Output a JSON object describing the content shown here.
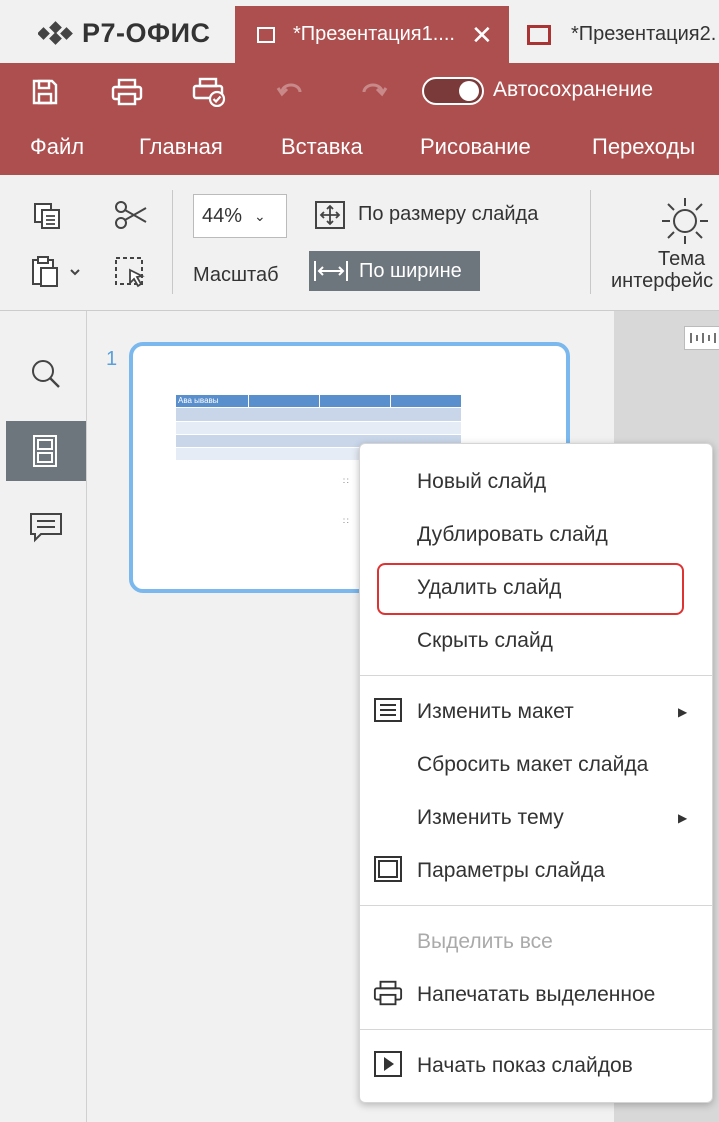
{
  "app": {
    "logo": "Р7-ОФИС"
  },
  "tabs": [
    {
      "label": "*Презентация1....",
      "close": "✕",
      "active": true
    },
    {
      "label": "*Презентация2.",
      "active": false
    }
  ],
  "quick_toolbar": {
    "icons": [
      "save-icon",
      "print-icon",
      "quick-print-icon",
      "undo-icon",
      "redo-icon"
    ],
    "autosave_label": "Автосохранение"
  },
  "menu": [
    "Файл",
    "Главная",
    "Вставка",
    "Рисование",
    "Переходы"
  ],
  "ribbon": {
    "zoom_value": "44%",
    "fit_slide_label": "По размеру слайда",
    "scale_label": "Масштаб",
    "fit_width_label": "По ширине",
    "theme_label_line1": "Тема",
    "theme_label_line2": "интерфейс"
  },
  "slides": {
    "number": "1",
    "table_header_text": "Ава  ывавы"
  },
  "context_menu": {
    "items": [
      {
        "label": "Новый слайд"
      },
      {
        "label": "Дублировать слайд"
      },
      {
        "label": "Удалить слайд",
        "highlighted": true
      },
      {
        "label": "Скрыть слайд"
      },
      {
        "label": "Изменить макет",
        "icon": "layout-icon",
        "submenu": true
      },
      {
        "label": "Сбросить макет слайда"
      },
      {
        "label": "Изменить тему",
        "submenu": true
      },
      {
        "label": "Параметры слайда",
        "icon": "slide-settings-icon"
      },
      {
        "label": "Выделить все",
        "disabled": true
      },
      {
        "label": "Напечатать выделенное",
        "icon": "print-icon"
      },
      {
        "label": "Начать показ слайдов",
        "icon": "play-icon"
      }
    ]
  },
  "colors": {
    "accent": "#ad4f4f",
    "selection": "#7ab8ee",
    "highlight": "#dd3333"
  }
}
